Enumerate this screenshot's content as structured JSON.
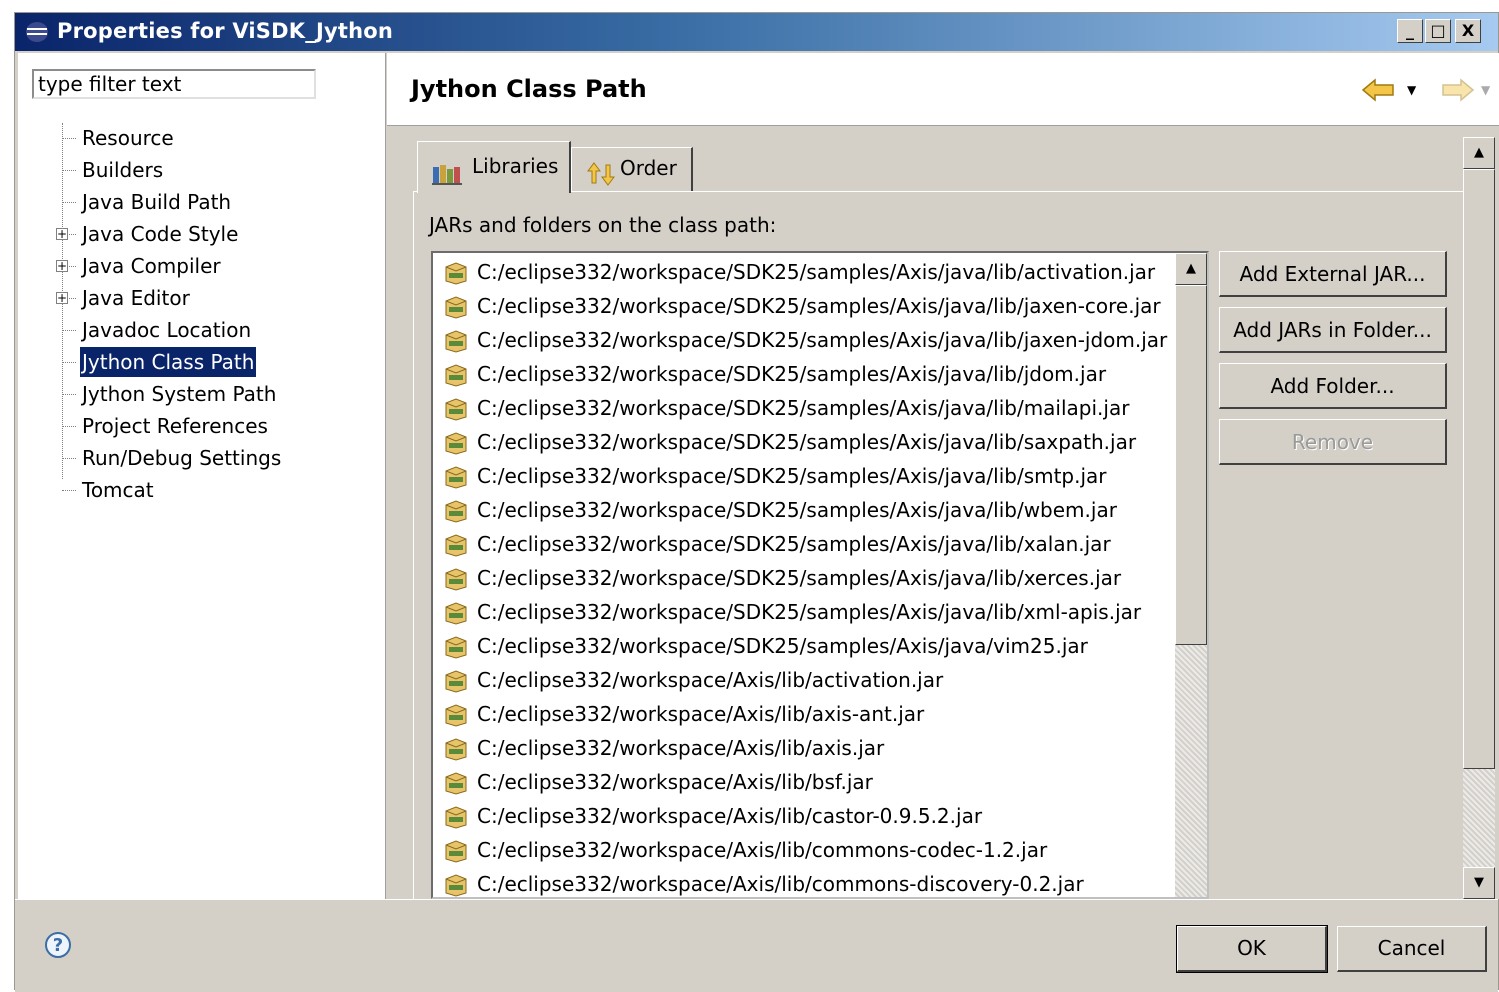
{
  "window": {
    "title": "Properties for ViSDK_Jython",
    "controls": {
      "minimize": "_",
      "maximize": "□",
      "close": "X"
    }
  },
  "filter": {
    "value": "type filter text"
  },
  "tree": {
    "items": [
      {
        "label": "Resource",
        "expandable": false,
        "selected": false
      },
      {
        "label": "Builders",
        "expandable": false,
        "selected": false
      },
      {
        "label": "Java Build Path",
        "expandable": false,
        "selected": false
      },
      {
        "label": "Java Code Style",
        "expandable": true,
        "selected": false
      },
      {
        "label": "Java Compiler",
        "expandable": true,
        "selected": false
      },
      {
        "label": "Java Editor",
        "expandable": true,
        "selected": false
      },
      {
        "label": "Javadoc Location",
        "expandable": false,
        "selected": false
      },
      {
        "label": "Jython Class Path",
        "expandable": false,
        "selected": true
      },
      {
        "label": "Jython System Path",
        "expandable": false,
        "selected": false
      },
      {
        "label": "Project References",
        "expandable": false,
        "selected": false
      },
      {
        "label": "Run/Debug Settings",
        "expandable": false,
        "selected": false
      },
      {
        "label": "Tomcat",
        "expandable": false,
        "selected": false
      }
    ]
  },
  "page": {
    "title": "Jython Class Path",
    "tabs": [
      {
        "label": "Libraries",
        "active": true
      },
      {
        "label": "Order",
        "active": false
      }
    ],
    "list_caption": "JARs and folders on the class path:",
    "entries": [
      "C:/eclipse332/workspace/SDK25/samples/Axis/java/lib/activation.jar",
      "C:/eclipse332/workspace/SDK25/samples/Axis/java/lib/jaxen-core.jar",
      "C:/eclipse332/workspace/SDK25/samples/Axis/java/lib/jaxen-jdom.jar",
      "C:/eclipse332/workspace/SDK25/samples/Axis/java/lib/jdom.jar",
      "C:/eclipse332/workspace/SDK25/samples/Axis/java/lib/mailapi.jar",
      "C:/eclipse332/workspace/SDK25/samples/Axis/java/lib/saxpath.jar",
      "C:/eclipse332/workspace/SDK25/samples/Axis/java/lib/smtp.jar",
      "C:/eclipse332/workspace/SDK25/samples/Axis/java/lib/wbem.jar",
      "C:/eclipse332/workspace/SDK25/samples/Axis/java/lib/xalan.jar",
      "C:/eclipse332/workspace/SDK25/samples/Axis/java/lib/xerces.jar",
      "C:/eclipse332/workspace/SDK25/samples/Axis/java/lib/xml-apis.jar",
      "C:/eclipse332/workspace/SDK25/samples/Axis/java/vim25.jar",
      "C:/eclipse332/workspace/Axis/lib/activation.jar",
      "C:/eclipse332/workspace/Axis/lib/axis-ant.jar",
      "C:/eclipse332/workspace/Axis/lib/axis.jar",
      "C:/eclipse332/workspace/Axis/lib/bsf.jar",
      "C:/eclipse332/workspace/Axis/lib/castor-0.9.5.2.jar",
      "C:/eclipse332/workspace/Axis/lib/commons-codec-1.2.jar",
      "C:/eclipse332/workspace/Axis/lib/commons-discovery-0.2.jar"
    ],
    "buttons": {
      "add_external_jar": "Add External JAR...",
      "add_jars_in_folder": "Add JARs in Folder...",
      "add_folder": "Add Folder...",
      "remove": "Remove"
    }
  },
  "dialog": {
    "ok": "OK",
    "cancel": "Cancel"
  },
  "icons": {
    "title": "eclipse-icon",
    "tab_libraries": "library-icon",
    "tab_order": "order-icon",
    "entry": "jar-icon",
    "help": "help-icon",
    "back": "back-arrow-icon",
    "forward": "forward-arrow-icon"
  },
  "colors": {
    "selection": "#0a246a",
    "title_bar": "#0a246a",
    "dialog_bg": "#d4d0c8"
  }
}
